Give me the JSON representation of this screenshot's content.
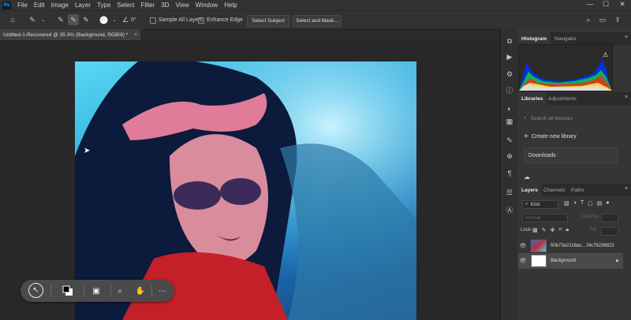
{
  "app": {
    "menu": [
      "File",
      "Edit",
      "Image",
      "Layer",
      "Type",
      "Select",
      "Filter",
      "3D",
      "View",
      "Window",
      "Help"
    ],
    "window_controls": {
      "minimize": "—",
      "maximize": "☐",
      "close": "✕"
    }
  },
  "options_bar": {
    "brush_size": "30",
    "angle": "0°",
    "sample_all_layers": "Sample All Layers",
    "enhance_edge": "Enhance Edge",
    "select_subject": "Select Subject",
    "select_and_mask": "Select and Mask..."
  },
  "document": {
    "tab_title": "Untitled-1-Recovered @ 35.3% (Background, RGB/8) *",
    "close": "×"
  },
  "panels": {
    "histogram": {
      "tab": "Histogram",
      "tab2": "Navigator",
      "menu": "≡",
      "warning": "⚠"
    },
    "libraries": {
      "tab": "Libraries",
      "tab2": "Adjustments",
      "search_placeholder": "Search all libraries",
      "create": "Create new library",
      "item": "Downloads"
    },
    "layers": {
      "tabs": [
        "Layers",
        "Channels",
        "Paths"
      ],
      "filter_kind": "Kind",
      "blend_mode": "Normal",
      "opacity_label": "Opacity:",
      "lock_label": "Lock:",
      "fill_label": "Fill:",
      "rows": [
        {
          "name": "50b73e21c8ac....f4c76236822"
        },
        {
          "name": "Background"
        }
      ]
    }
  },
  "colors": {
    "accent": "#31a8ff",
    "panel": "#353535",
    "bg": "#282828"
  }
}
